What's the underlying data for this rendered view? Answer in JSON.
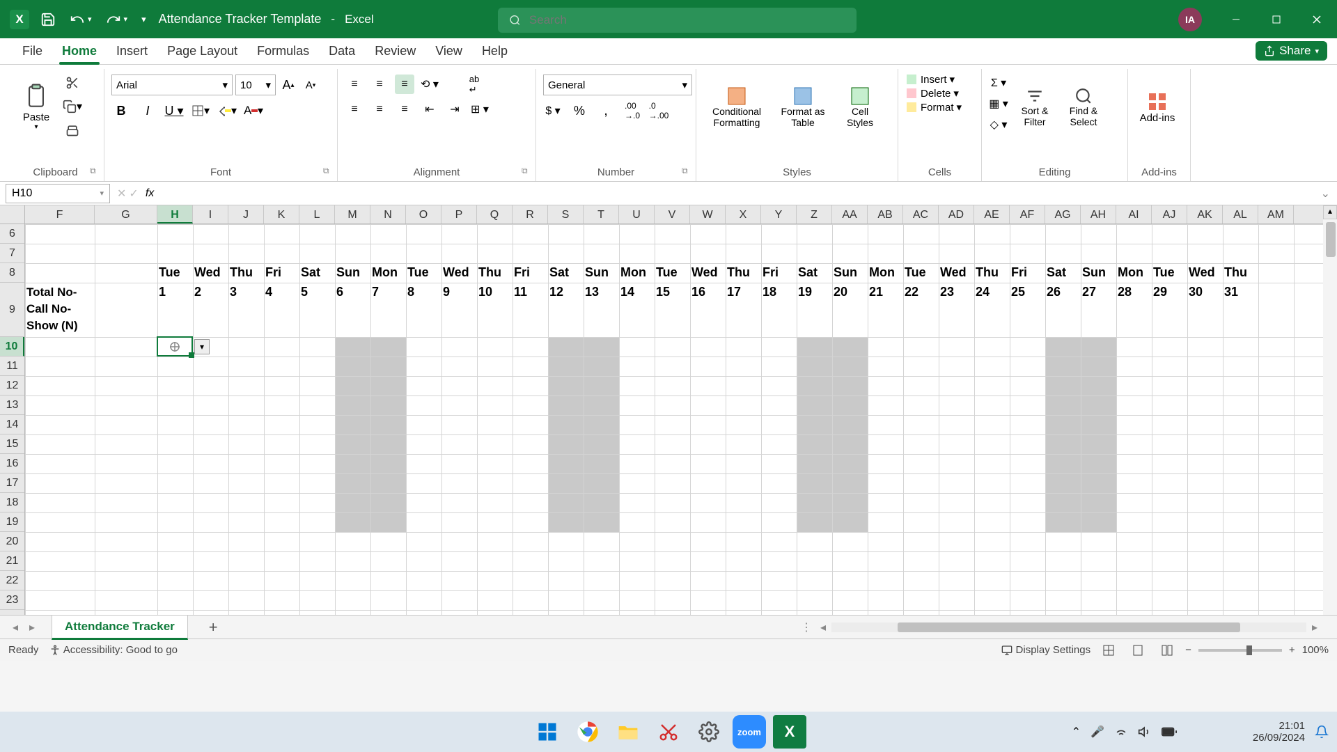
{
  "title_bar": {
    "doc_name": "Attendance Tracker Template",
    "app_name": "Excel",
    "search_placeholder": "Search",
    "avatar": "IA"
  },
  "tabs": {
    "file": "File",
    "home": "Home",
    "insert": "Insert",
    "page_layout": "Page Layout",
    "formulas": "Formulas",
    "data": "Data",
    "review": "Review",
    "view": "View",
    "help": "Help",
    "share": "Share"
  },
  "ribbon": {
    "clipboard": "Clipboard",
    "paste": "Paste",
    "font": "Font",
    "font_name": "Arial",
    "font_size": "10",
    "alignment": "Alignment",
    "number": "Number",
    "number_format": "General",
    "styles": "Styles",
    "cond_fmt": "Conditional Formatting",
    "fmt_table": "Format as Table",
    "cell_styles": "Cell Styles",
    "cells": "Cells",
    "insert": "Insert",
    "delete": "Delete",
    "format": "Format",
    "editing": "Editing",
    "sort_filter": "Sort & Filter",
    "find_select": "Find & Select",
    "addins": "Add-ins",
    "addins_label": "Add-ins"
  },
  "formula_bar": {
    "name_box": "H10",
    "formula": ""
  },
  "columns": [
    "F",
    "G",
    "H",
    "I",
    "J",
    "K",
    "L",
    "M",
    "N",
    "O",
    "P",
    "Q",
    "R",
    "S",
    "T",
    "U",
    "V",
    "W",
    "X",
    "Y",
    "Z",
    "AA",
    "AB",
    "AC",
    "AD",
    "AE",
    "AF",
    "AG",
    "AH",
    "AI",
    "AJ",
    "AK",
    "AL",
    "AM"
  ],
  "selected_col": "H",
  "rows": [
    "6",
    "7",
    "8",
    "9",
    "10",
    "11",
    "12",
    "13",
    "14",
    "15",
    "16",
    "17",
    "18",
    "19",
    "20",
    "21",
    "22",
    "23"
  ],
  "selected_row": "10",
  "row9_header": "Total No-Call No-Show (N)",
  "days": [
    {
      "col": 2,
      "day": "Tue",
      "num": "1"
    },
    {
      "col": 3,
      "day": "Wed",
      "num": "2"
    },
    {
      "col": 4,
      "day": "Thu",
      "num": "3"
    },
    {
      "col": 5,
      "day": "Fri",
      "num": "4"
    },
    {
      "col": 6,
      "day": "Sat",
      "num": "5"
    },
    {
      "col": 7,
      "day": "Sun",
      "num": "6"
    },
    {
      "col": 8,
      "day": "Mon",
      "num": "7"
    },
    {
      "col": 9,
      "day": "Tue",
      "num": "8"
    },
    {
      "col": 10,
      "day": "Wed",
      "num": "9"
    },
    {
      "col": 11,
      "day": "Thu",
      "num": "10"
    },
    {
      "col": 12,
      "day": "Fri",
      "num": "11"
    },
    {
      "col": 13,
      "day": "Sat",
      "num": "12"
    },
    {
      "col": 14,
      "day": "Sun",
      "num": "13"
    },
    {
      "col": 15,
      "day": "Mon",
      "num": "14"
    },
    {
      "col": 16,
      "day": "Tue",
      "num": "15"
    },
    {
      "col": 17,
      "day": "Wed",
      "num": "16"
    },
    {
      "col": 18,
      "day": "Thu",
      "num": "17"
    },
    {
      "col": 19,
      "day": "Fri",
      "num": "18"
    },
    {
      "col": 20,
      "day": "Sat",
      "num": "19"
    },
    {
      "col": 21,
      "day": "Sun",
      "num": "20"
    },
    {
      "col": 22,
      "day": "Mon",
      "num": "21"
    },
    {
      "col": 23,
      "day": "Tue",
      "num": "22"
    },
    {
      "col": 24,
      "day": "Wed",
      "num": "23"
    },
    {
      "col": 25,
      "day": "Thu",
      "num": "24"
    },
    {
      "col": 26,
      "day": "Fri",
      "num": "25"
    },
    {
      "col": 27,
      "day": "Sat",
      "num": "26"
    },
    {
      "col": 28,
      "day": "Sun",
      "num": "27"
    },
    {
      "col": 29,
      "day": "Mon",
      "num": "28"
    },
    {
      "col": 30,
      "day": "Tue",
      "num": "29"
    },
    {
      "col": 31,
      "day": "Wed",
      "num": "30"
    },
    {
      "col": 32,
      "day": "Thu",
      "num": "31"
    }
  ],
  "shaded_weekend_cols": [
    [
      7,
      8
    ],
    [
      13,
      14
    ],
    [
      20,
      21
    ],
    [
      27,
      28
    ]
  ],
  "col_widths": {
    "first": 100,
    "g": 90,
    "rest": 51
  },
  "row_heights": {
    "normal": 28,
    "r8": 28,
    "r9": 78
  },
  "sheet_tabs": {
    "active": "Attendance Tracker"
  },
  "status": {
    "ready": "Ready",
    "accessibility": "Accessibility: Good to go",
    "display_settings": "Display Settings",
    "zoom": "100%"
  },
  "taskbar": {
    "time": "21:01",
    "date": "26/09/2024"
  }
}
